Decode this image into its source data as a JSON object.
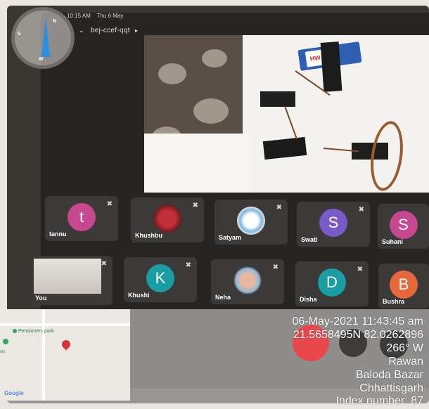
{
  "status_bar": {
    "time": "10:15 AM",
    "date": "Thu 6 May"
  },
  "meeting": {
    "code": "bej-ccef-qqt"
  },
  "compass": {
    "labels": [
      "N",
      "S",
      "W"
    ],
    "needle_color": "#2a8fe0"
  },
  "battery_label": "HW",
  "participants": [
    {
      "name": "tannu",
      "initial": "t",
      "color": "#c8488f",
      "muted": true
    },
    {
      "name": "Khushbu",
      "initial": "",
      "color": "#b3242e",
      "muted": true,
      "avatar": "rose-photo"
    },
    {
      "name": "Satyam",
      "initial": "",
      "color": "#ffffff",
      "muted": true,
      "avatar": "cartoon-photo"
    },
    {
      "name": "Swati",
      "initial": "S",
      "color": "#7a5ac8",
      "muted": true
    },
    {
      "name": "Suhani",
      "initial": "S",
      "color": "#c8488f",
      "muted": true
    },
    {
      "name": "You",
      "initial": "",
      "color": "#ddd8d1",
      "muted": true,
      "avatar": "self-video"
    },
    {
      "name": "Khushi",
      "initial": "K",
      "color": "#1a9ea3",
      "muted": true
    },
    {
      "name": "Neha",
      "initial": "",
      "color": "#8fb8d8",
      "muted": true,
      "avatar": "girl-photo"
    },
    {
      "name": "Disha",
      "initial": "D",
      "color": "#1a9ea3",
      "muted": true
    },
    {
      "name": "Bushra",
      "initial": "B",
      "color": "#e6683c",
      "muted": false
    }
  ],
  "map": {
    "poi": "Pensioners park",
    "attribution": "Google",
    "edge_label": "sis"
  },
  "geo_stamp": {
    "datetime": "06-May-2021 11:43:45 am",
    "coords": "21.5658495N 82.0262896",
    "heading": "266° W",
    "place": "Rawan",
    "district": "Baloda Bazar",
    "state": "Chhattisgarh",
    "index": "Index number: 87"
  }
}
